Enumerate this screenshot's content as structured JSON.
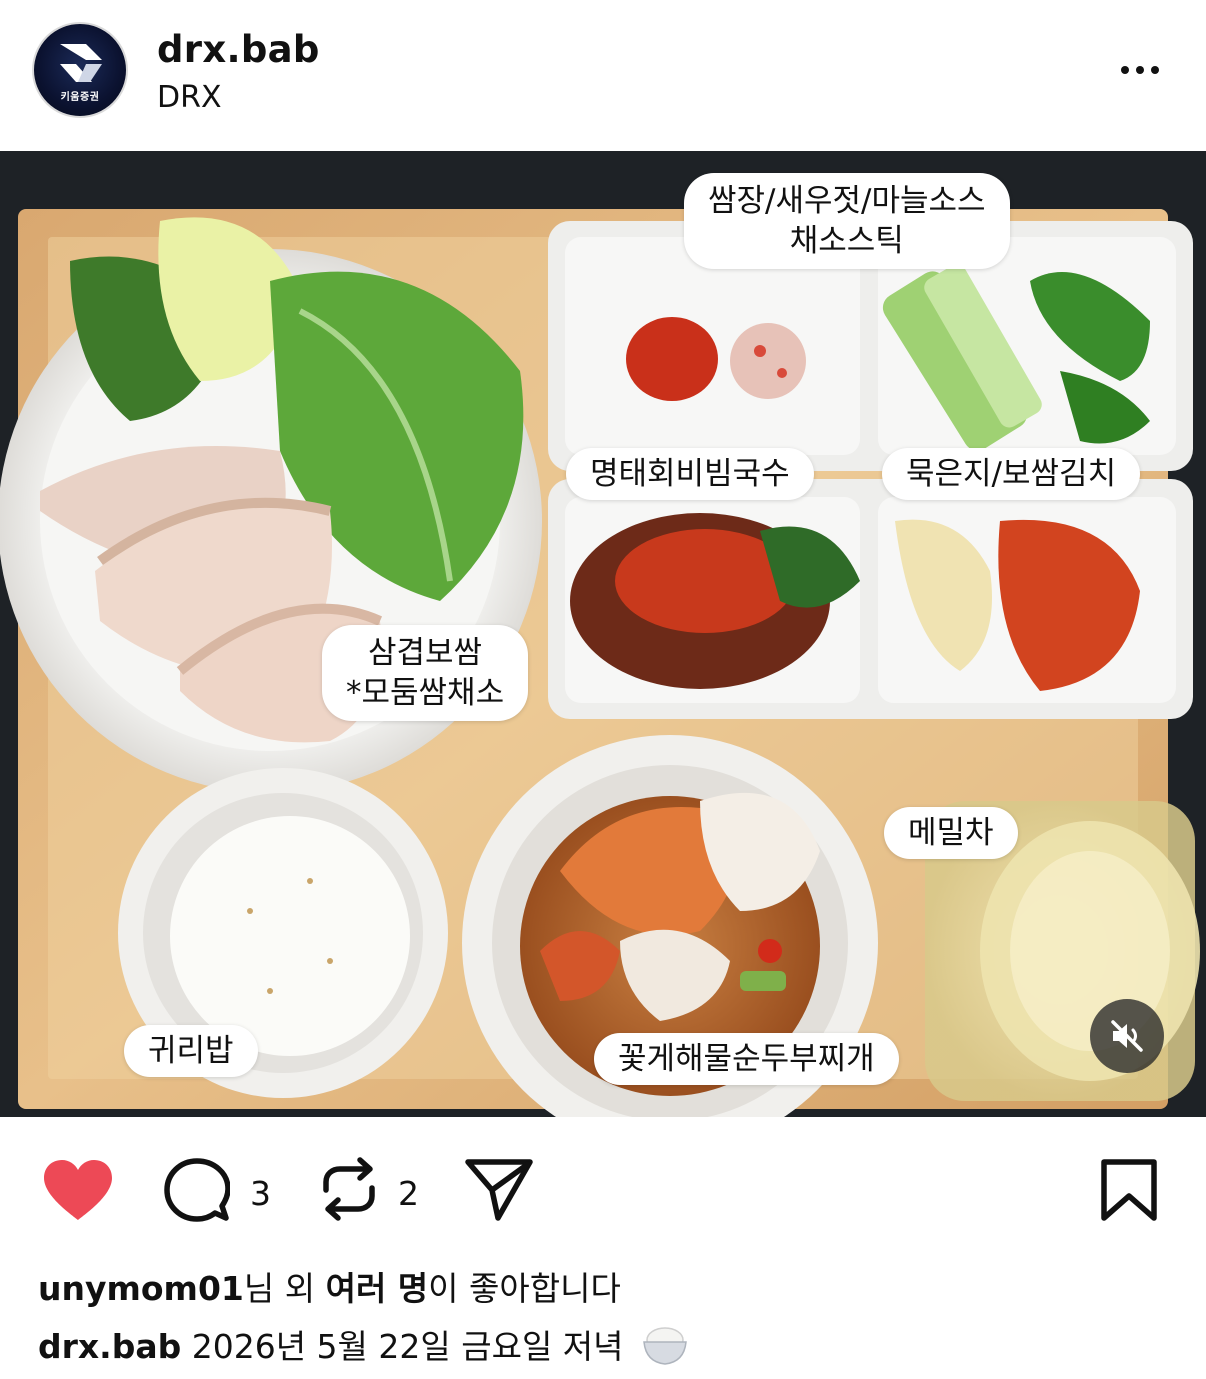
{
  "post": {
    "username": "drx.bab",
    "subtitle": "DRX",
    "avatar_caption": "키움증권",
    "more_icon": "more-horizontal-icon"
  },
  "photo": {
    "labels": {
      "sauce": "쌈장/새우젓/마늘소스",
      "sticks": "채소스틱",
      "noodles": "명태회비빔국수",
      "kimchi": "묵은지/보쌈김치",
      "bossam": "삼겹보쌈",
      "greens": "*모둠쌈채소",
      "tea": "메밀차",
      "rice": "귀리밥",
      "stew": "꽃게해물순두부찌개"
    },
    "mute_icon": "speaker-muted-icon"
  },
  "actions": {
    "like_icon": "heart-filled-icon",
    "comment_icon": "comment-bubble-icon",
    "comment_count": "3",
    "repost_icon": "repost-arrows-icon",
    "repost_count": "2",
    "share_icon": "send-paper-plane-icon",
    "save_icon": "bookmark-icon",
    "like_color": "#ed4956"
  },
  "likes": {
    "user": "unymom01",
    "mid": "님 외 ",
    "bold": "여러 명",
    "tail": "이 좋아합니다"
  },
  "caption": {
    "username": "drx.bab",
    "text": " 2026년 5월 22일 금요일 저녁",
    "emoji_icon": "rice-bowl-emoji-icon"
  }
}
